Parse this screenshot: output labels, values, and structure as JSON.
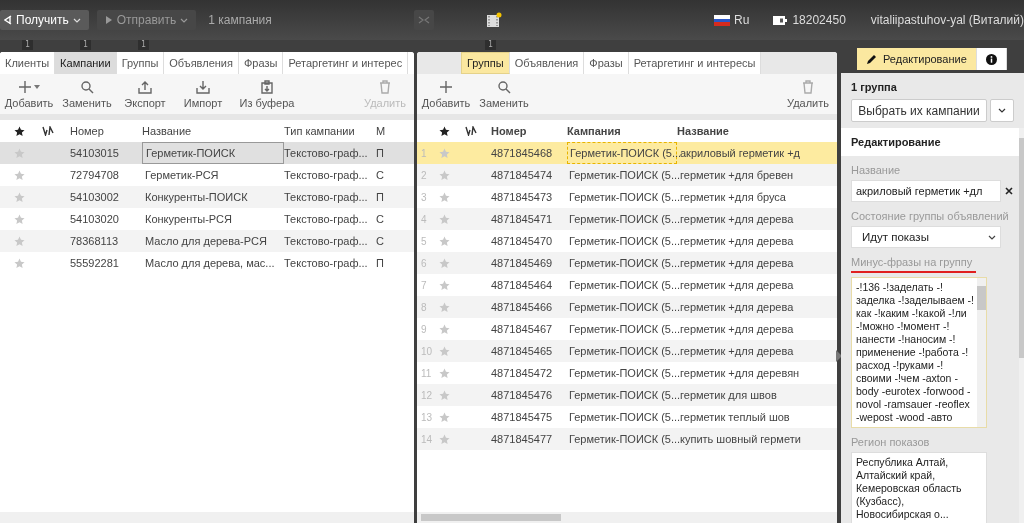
{
  "topbar": {
    "get_button": {
      "label": "Получить"
    },
    "send_button": {
      "label": "Отправить",
      "disabled": true
    },
    "selection_info": "1 кампания",
    "language": "Ru",
    "balance": "18202450",
    "user": "vitaliipastuhov-yal (Виталий)"
  },
  "left_panel": {
    "counters": [
      "1",
      "1",
      "1"
    ],
    "tabs": [
      {
        "label": "Клиенты",
        "selected": false
      },
      {
        "label": "Кампании",
        "selected": true
      },
      {
        "label": "Группы",
        "selected": false
      },
      {
        "label": "Объявления",
        "selected": false
      },
      {
        "label": "Фразы",
        "selected": false
      },
      {
        "label": "Ретаргетинг и интерес",
        "selected": false
      }
    ],
    "actions": [
      {
        "label": "Добавить",
        "kind": "add",
        "disabled": false
      },
      {
        "label": "Заменить",
        "kind": "replace",
        "disabled": false
      },
      {
        "label": "Экспорт",
        "kind": "export",
        "disabled": false
      },
      {
        "label": "Импорт",
        "kind": "import",
        "disabled": false
      },
      {
        "label": "Из буфера",
        "kind": "clipboard",
        "disabled": false
      },
      {
        "label": "Удалить",
        "kind": "delete",
        "disabled": true
      }
    ],
    "columns": [
      "Номер",
      "Название",
      "Тип кампании",
      "М"
    ],
    "rows": [
      {
        "starred": false,
        "selected": true,
        "cells": [
          "54103015",
          "Герметик-ПОИСК",
          "Текстово-граф...",
          "П"
        ]
      },
      {
        "starred": false,
        "selected": false,
        "cells": [
          "72794708",
          "Герметик-РСЯ",
          "Текстово-граф...",
          "С"
        ]
      },
      {
        "starred": false,
        "selected": false,
        "cells": [
          "54103002",
          "Конкуренты-ПОИСК",
          "Текстово-граф...",
          "П"
        ]
      },
      {
        "starred": false,
        "selected": false,
        "cells": [
          "54103020",
          "Конкуренты-РСЯ",
          "Текстово-граф...",
          "С"
        ]
      },
      {
        "starred": false,
        "selected": false,
        "cells": [
          "78368113",
          "Масло для дерева-РСЯ",
          "Текстово-граф...",
          "С"
        ]
      },
      {
        "starred": false,
        "selected": false,
        "cells": [
          "55592281",
          "Масло для дерева, мас...",
          "Текстово-граф...",
          "П"
        ]
      }
    ]
  },
  "middle_panel": {
    "counters": [
      "1"
    ],
    "tabs": [
      {
        "label": "Группы",
        "selected": true
      },
      {
        "label": "Объявления",
        "selected": false
      },
      {
        "label": "Фразы",
        "selected": false
      },
      {
        "label": "Ретаргетинг и интересы",
        "selected": false
      }
    ],
    "actions": [
      {
        "label": "Добавить",
        "kind": "add",
        "disabled": false
      },
      {
        "label": "Заменить",
        "kind": "replace",
        "disabled": false
      },
      {
        "label": "Удалить",
        "kind": "delete",
        "disabled": false
      }
    ],
    "columns": [
      "Номер",
      "Кампания",
      "Название"
    ],
    "rows": [
      {
        "index": "1",
        "starred": false,
        "selected": true,
        "number": "4871845468",
        "campaign": "Герметик-ПОИСК (5...",
        "name": "акриловый герметик +д"
      },
      {
        "index": "2",
        "starred": false,
        "selected": false,
        "number": "4871845474",
        "campaign": "Герметик-ПОИСК (5...",
        "name": "герметик +для бревен"
      },
      {
        "index": "3",
        "starred": false,
        "selected": false,
        "number": "4871845473",
        "campaign": "Герметик-ПОИСК (5...",
        "name": "герметик +для бруса"
      },
      {
        "index": "4",
        "starred": false,
        "selected": false,
        "number": "4871845471",
        "campaign": "Герметик-ПОИСК (5...",
        "name": "герметик +для дерева"
      },
      {
        "index": "5",
        "starred": false,
        "selected": false,
        "number": "4871845470",
        "campaign": "Герметик-ПОИСК (5...",
        "name": "герметик +для дерева"
      },
      {
        "index": "6",
        "starred": false,
        "selected": false,
        "number": "4871845469",
        "campaign": "Герметик-ПОИСК (5...",
        "name": "герметик +для дерева"
      },
      {
        "index": "7",
        "starred": false,
        "selected": false,
        "number": "4871845464",
        "campaign": "Герметик-ПОИСК (5...",
        "name": "герметик +для дерева"
      },
      {
        "index": "8",
        "starred": false,
        "selected": false,
        "number": "4871845466",
        "campaign": "Герметик-ПОИСК (5...",
        "name": "герметик +для дерева"
      },
      {
        "index": "9",
        "starred": false,
        "selected": false,
        "number": "4871845467",
        "campaign": "Герметик-ПОИСК (5...",
        "name": "герметик +для дерева"
      },
      {
        "index": "10",
        "starred": false,
        "selected": false,
        "number": "4871845465",
        "campaign": "Герметик-ПОИСК (5...",
        "name": "герметик +для дерева"
      },
      {
        "index": "11",
        "starred": false,
        "selected": false,
        "number": "4871845472",
        "campaign": "Герметик-ПОИСК (5...",
        "name": "герметик +для деревян"
      },
      {
        "index": "12",
        "starred": false,
        "selected": false,
        "number": "4871845476",
        "campaign": "Герметик-ПОИСК (5...",
        "name": "герметик для швов"
      },
      {
        "index": "13",
        "starred": false,
        "selected": false,
        "number": "4871845475",
        "campaign": "Герметик-ПОИСК (5...",
        "name": "герметик теплый шов"
      },
      {
        "index": "14",
        "starred": false,
        "selected": false,
        "number": "4871845477",
        "campaign": "Герметик-ПОИСК (5...",
        "name": "купить шовный гермети"
      }
    ]
  },
  "right_panel": {
    "tabs": [
      {
        "kind": "edit",
        "label": "Редактирование",
        "selected": true
      },
      {
        "kind": "info",
        "selected": false
      }
    ],
    "selection_title": "1 группа",
    "select_button": "Выбрать их кампании",
    "section_title": "Редактирование",
    "fields": [
      {
        "kind": "text",
        "label": "Название",
        "value": "акриловый герметик +дл",
        "underlined": false
      },
      {
        "kind": "select",
        "label": "Состояние группы объявлений",
        "value": "Идут показы",
        "underlined": false
      },
      {
        "kind": "textarea",
        "label": "Минус-фразы на группу",
        "value": "-!136 -!заделать -!заделка -!заделываем -!как -!каким -!какой -!ли -!можно -!момент -!нанести -!наносим -!применение -!работа -!расход -!руками -!своими -!чем -axton -body -eurotex -forwood -novol -ramsauer -reoflex -wepost -wood -авто",
        "underlined": true
      },
      {
        "kind": "box",
        "label": "Регион показов",
        "value": "Республика Алтай, Алтайский край, Кемеровская область (Кузбасс), Новосибирская о...",
        "underlined": false
      }
    ]
  }
}
